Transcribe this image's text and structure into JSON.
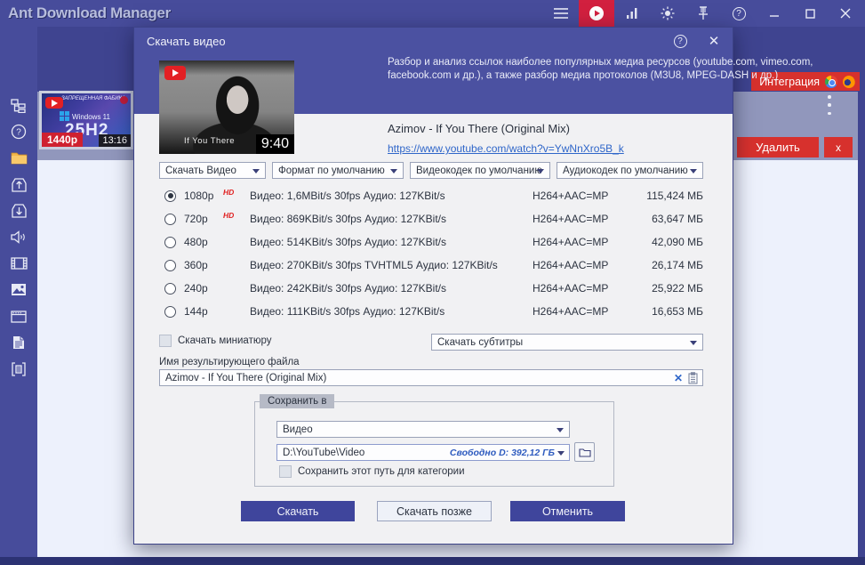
{
  "window": {
    "title": "Ant Download Manager",
    "integration_button": "Интеграция",
    "delete_button": "Удалить",
    "close_item_button": "x"
  },
  "list_item": {
    "overlay_line1": "ЗАПРЕЩЕННАЯ ФАБИКА",
    "overlay_line2": "Windows 11",
    "overlay_big": "25H2",
    "badge_resolution": "1440p",
    "badge_duration": "13:16"
  },
  "dialog": {
    "title": "Скачать видео",
    "help_glyph": "?",
    "close_glyph": "✕",
    "description": "Разбор и анализ ссылок наиболее популярных медиа ресурсов (youtube.com, vimeo.com, facebook.com и др.), а также разбор медиа протоколов (M3U8, MPEG-DASH и др.)",
    "video": {
      "title": "Azimov - If You There (Original Mix)",
      "url": "https://www.youtube.com/watch?v=YwNnXro5B_k",
      "duration": "9:40",
      "thumb_caption": "If You There"
    },
    "dropdowns": {
      "action": "Скачать Видео",
      "format": "Формат по умолчанию",
      "vcodec": "Видеокодек по умолчанию",
      "acodec": "Аудиокодек по умолчанию",
      "subtitles": "Скачать субтитры"
    },
    "quality": {
      "rows": [
        {
          "res": "1080p",
          "hd": "HD",
          "info": "Видео: 1,6MBit/s 30fps Аудио: 127KBit/s",
          "codec": "H264+AAC=MP",
          "size": "115,424 МБ"
        },
        {
          "res": "720p",
          "hd": "HD",
          "info": "Видео: 869KBit/s 30fps Аудио: 127KBit/s",
          "codec": "H264+AAC=MP",
          "size": "63,647 МБ"
        },
        {
          "res": "480p",
          "hd": "",
          "info": "Видео: 514KBit/s 30fps Аудио: 127KBit/s",
          "codec": "H264+AAC=MP",
          "size": "42,090 МБ"
        },
        {
          "res": "360p",
          "hd": "",
          "info": "Видео: 270KBit/s 30fps TVHTML5 Аудио: 127KBit/s",
          "codec": "H264+AAC=MP",
          "size": "26,174 МБ"
        },
        {
          "res": "240p",
          "hd": "",
          "info": "Видео: 242KBit/s 30fps Аудио: 127KBit/s",
          "codec": "H264+AAC=MP",
          "size": "25,922 МБ"
        },
        {
          "res": "144p",
          "hd": "",
          "info": "Видео: 111KBit/s 30fps Аудио: 127KBit/s",
          "codec": "H264+AAC=MP",
          "size": "16,653 МБ"
        }
      ]
    },
    "thumbnail_checkbox_label": "Скачать миниатюру",
    "filename_label": "Имя результирующего файла",
    "filename_value": "Azimov - If You There (Original Mix)",
    "save_group": {
      "title": "Сохранить в",
      "category": "Видео",
      "path": "D:\\YouTube\\Video",
      "free_space": "Свободно D: 392,12 ГБ",
      "save_path_checkbox_label": "Сохранить этот путь для категории"
    },
    "buttons": {
      "download": "Скачать",
      "later": "Скачать позже",
      "cancel": "Отменить"
    }
  },
  "colors": {
    "accent_red": "#d7312d",
    "tab_red": "#d2203f",
    "frame_indigo": "#474c9b",
    "button_indigo": "#3f459c",
    "link_blue": "#2f66c9"
  }
}
